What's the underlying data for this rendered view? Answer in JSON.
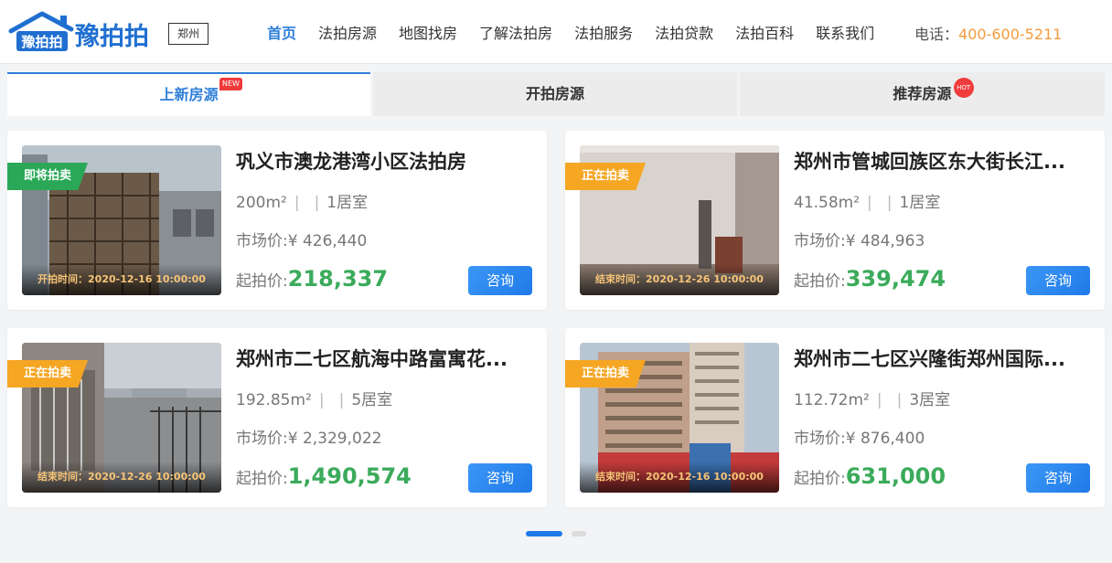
{
  "header": {
    "logo_text": "豫拍拍",
    "logo_badge": "豫拍拍",
    "city": "郑州",
    "nav": [
      "首页",
      "法拍房源",
      "地图找房",
      "了解法拍房",
      "法拍服务",
      "法拍贷款",
      "法拍百科",
      "联系我们"
    ],
    "phone_label": "电话：",
    "phone_number": "400-600-5211"
  },
  "tabs": [
    {
      "label": "上新房源",
      "tag": "NEW"
    },
    {
      "label": "开拍房源",
      "tag": ""
    },
    {
      "label": "推荐房源",
      "tag": "HOT"
    }
  ],
  "listings": [
    {
      "badge": "即将拍卖",
      "badge_color": "#2aa857",
      "time": "开拍时间：2020-12-16 10:00:00",
      "title": "巩义市澳龙港湾小区法拍房",
      "area": "200m²",
      "sep1": "|",
      "sep2": "|",
      "rooms": "1居室",
      "market_label": "市场价:",
      "market_price": "¥ 426,440",
      "start_label": "起拍价:",
      "start_price": "218,337",
      "button": "咨询"
    },
    {
      "badge": "正在拍卖",
      "badge_color": "#f5a623",
      "time": "结束时间：2020-12-26 10:00:00",
      "title": "郑州市管城回族区东大街长江...",
      "area": "41.58m²",
      "sep1": "|",
      "sep2": "|",
      "rooms": "1居室",
      "market_label": "市场价:",
      "market_price": "¥ 484,963",
      "start_label": "起拍价:",
      "start_price": "339,474",
      "button": "咨询"
    },
    {
      "badge": "正在拍卖",
      "badge_color": "#f5a623",
      "time": "结束时间：2020-12-26 10:00:00",
      "title": "郑州市二七区航海中路富寓花...",
      "area": "192.85m²",
      "sep1": "|",
      "sep2": "|",
      "rooms": "5居室",
      "market_label": "市场价:",
      "market_price": "¥ 2,329,022",
      "start_label": "起拍价:",
      "start_price": "1,490,574",
      "button": "咨询"
    },
    {
      "badge": "正在拍卖",
      "badge_color": "#f5a623",
      "time": "结束时间：2020-12-16 10:00:00",
      "title": "郑州市二七区兴隆街郑州国际...",
      "area": "112.72m²",
      "sep1": "|",
      "sep2": "|",
      "rooms": "3居室",
      "market_label": "市场价:",
      "market_price": "¥ 876,400",
      "start_label": "起拍价:",
      "start_price": "631,000",
      "button": "咨询"
    }
  ],
  "colors": {
    "accent": "#2f7fd9",
    "price_green": "#3bab5b",
    "phone_orange": "#f39c3c"
  },
  "pager": {
    "pages": 2,
    "active": 1
  }
}
